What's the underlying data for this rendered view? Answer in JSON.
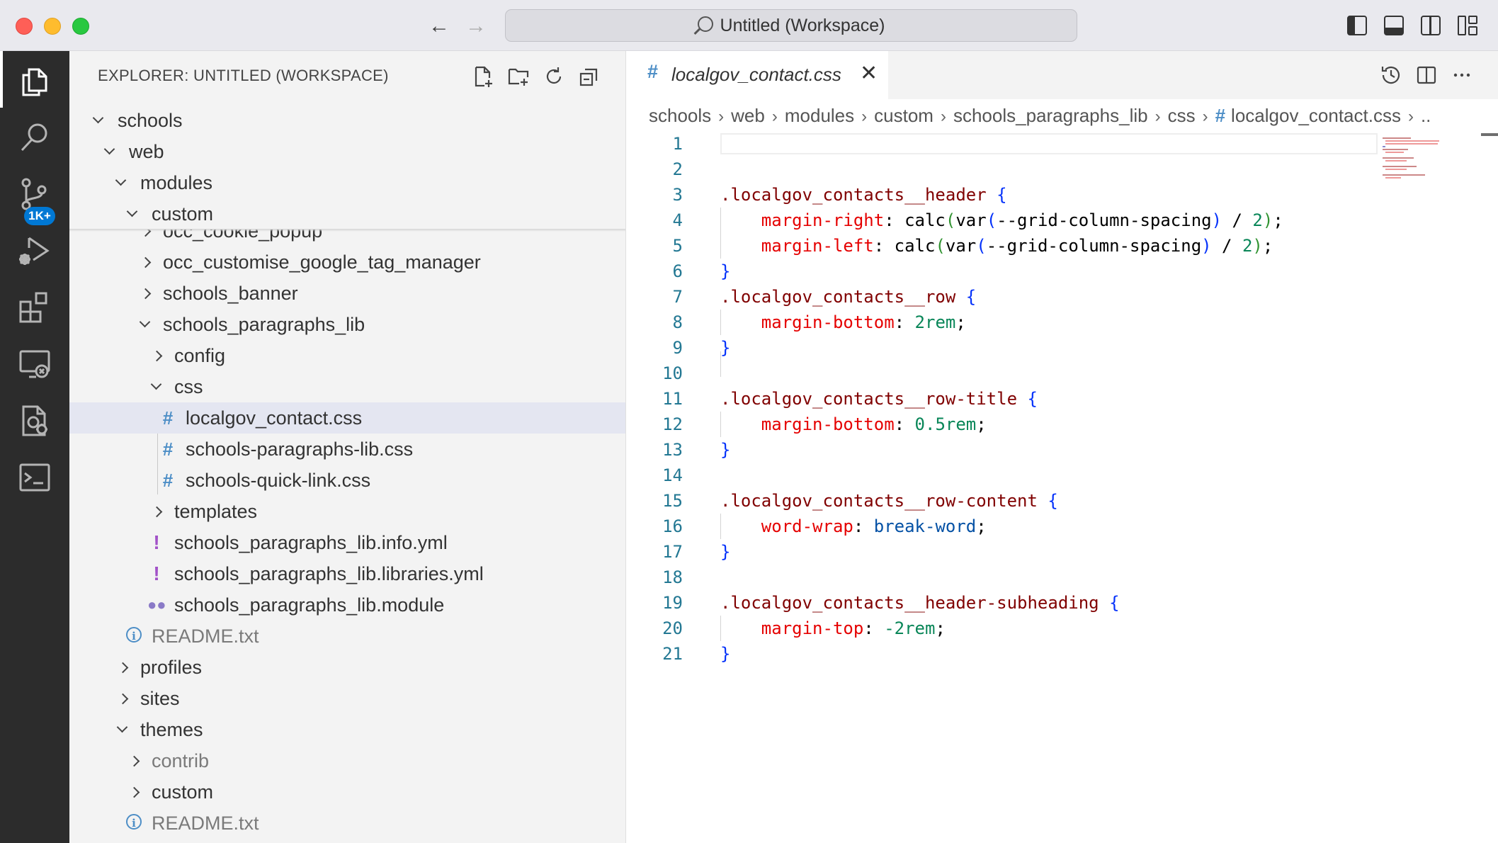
{
  "window": {
    "title": "Untitled (Workspace)"
  },
  "activity_bar": {
    "items": [
      {
        "name": "explorer"
      },
      {
        "name": "search"
      },
      {
        "name": "source-control",
        "badge": "1K+"
      },
      {
        "name": "run-and-debug"
      },
      {
        "name": "extensions"
      },
      {
        "name": "remote-explorer"
      },
      {
        "name": "testing"
      },
      {
        "name": "terminal"
      }
    ]
  },
  "sidebar": {
    "title": "EXPLORER: UNTITLED (WORKSPACE)",
    "tree": [
      {
        "label": "schools",
        "state": "expanded"
      },
      {
        "label": "web",
        "state": "expanded"
      },
      {
        "label": "modules",
        "state": "expanded"
      },
      {
        "label": "custom",
        "state": "expanded"
      },
      {
        "label": "occ_cookie_popup",
        "state": "collapsed"
      },
      {
        "label": "occ_customise_google_tag_manager",
        "state": "collapsed"
      },
      {
        "label": "schools_banner",
        "state": "collapsed"
      },
      {
        "label": "schools_paragraphs_lib",
        "state": "expanded"
      },
      {
        "label": "config",
        "state": "collapsed"
      },
      {
        "label": "css",
        "state": "expanded"
      },
      {
        "label": "localgov_contact.css",
        "icon": "#",
        "selected": true
      },
      {
        "label": "schools-paragraphs-lib.css",
        "icon": "#"
      },
      {
        "label": "schools-quick-link.css",
        "icon": "#"
      },
      {
        "label": "templates",
        "state": "collapsed"
      },
      {
        "label": "schools_paragraphs_lib.info.yml",
        "icon": "!"
      },
      {
        "label": "schools_paragraphs_lib.libraries.yml",
        "icon": "!"
      },
      {
        "label": "schools_paragraphs_lib.module",
        "icon": "php"
      },
      {
        "label": "README.txt",
        "icon": "info"
      },
      {
        "label": "profiles",
        "state": "collapsed"
      },
      {
        "label": "sites",
        "state": "collapsed"
      },
      {
        "label": "themes",
        "state": "expanded"
      },
      {
        "label": "contrib",
        "state": "collapsed"
      },
      {
        "label": "custom",
        "state": "collapsed"
      },
      {
        "label": "README.txt",
        "icon": "info"
      }
    ]
  },
  "editor": {
    "tab": {
      "icon": "#",
      "label": "localgov_contact.css"
    },
    "breadcrumb": [
      "schools",
      "web",
      "modules",
      "custom",
      "schools_paragraphs_lib",
      "css",
      "localgov_contact.css"
    ],
    "breadcrumb_icon": "#",
    "line_numbers": [
      "1",
      "2",
      "3",
      "4",
      "5",
      "6",
      "7",
      "8",
      "9",
      "10",
      "11",
      "12",
      "13",
      "14",
      "15",
      "16",
      "17",
      "18",
      "19",
      "20",
      "21"
    ],
    "code": {
      "l3_sel": ".localgov_contacts__header",
      "l3_brace": "{",
      "l4_prop": "margin-right",
      "l4_a": ": calc",
      "l4_p1": "(",
      "l4_b": "var",
      "l4_p2": "(",
      "l4_c": "--grid-column-spacing",
      "l4_p3": ")",
      "l4_d": " / ",
      "l4_num": "2",
      "l4_p4": ")",
      "l4_e": ";",
      "l5_prop": "margin-left",
      "l5_a": ": calc",
      "l5_p1": "(",
      "l5_b": "var",
      "l5_p2": "(",
      "l5_c": "--grid-column-spacing",
      "l5_p3": ")",
      "l5_d": " / ",
      "l5_num": "2",
      "l5_p4": ")",
      "l5_e": ";",
      "l6_brace": "}",
      "l7_sel": ".localgov_contacts__row",
      "l7_brace": "{",
      "l8_prop": "margin-bottom",
      "l8_a": ": ",
      "l8_num": "2rem",
      "l8_e": ";",
      "l9_brace": "}",
      "l11_sel": ".localgov_contacts__row-title",
      "l11_brace": "{",
      "l12_prop": "margin-bottom",
      "l12_a": ": ",
      "l12_num": "0.5rem",
      "l12_e": ";",
      "l13_brace": "}",
      "l15_sel": ".localgov_contacts__row-content",
      "l15_brace": "{",
      "l16_prop": "word-wrap",
      "l16_a": ": ",
      "l16_val": "break-word",
      "l16_e": ";",
      "l17_brace": "}",
      "l19_sel": ".localgov_contacts__header-subheading",
      "l19_brace": "{",
      "l20_prop": "margin-top",
      "l20_a": ": ",
      "l20_num": "-2rem",
      "l20_e": ";",
      "l21_brace": "}"
    }
  },
  "colors": {
    "activity_bar_bg": "#2c2c2c",
    "sidebar_bg": "#f3f3f3",
    "selection_bg": "#e4e6f1",
    "accent_badge": "#0078d4",
    "css_icon": "#4d8ec6",
    "yaml_icon": "#a251c8"
  }
}
